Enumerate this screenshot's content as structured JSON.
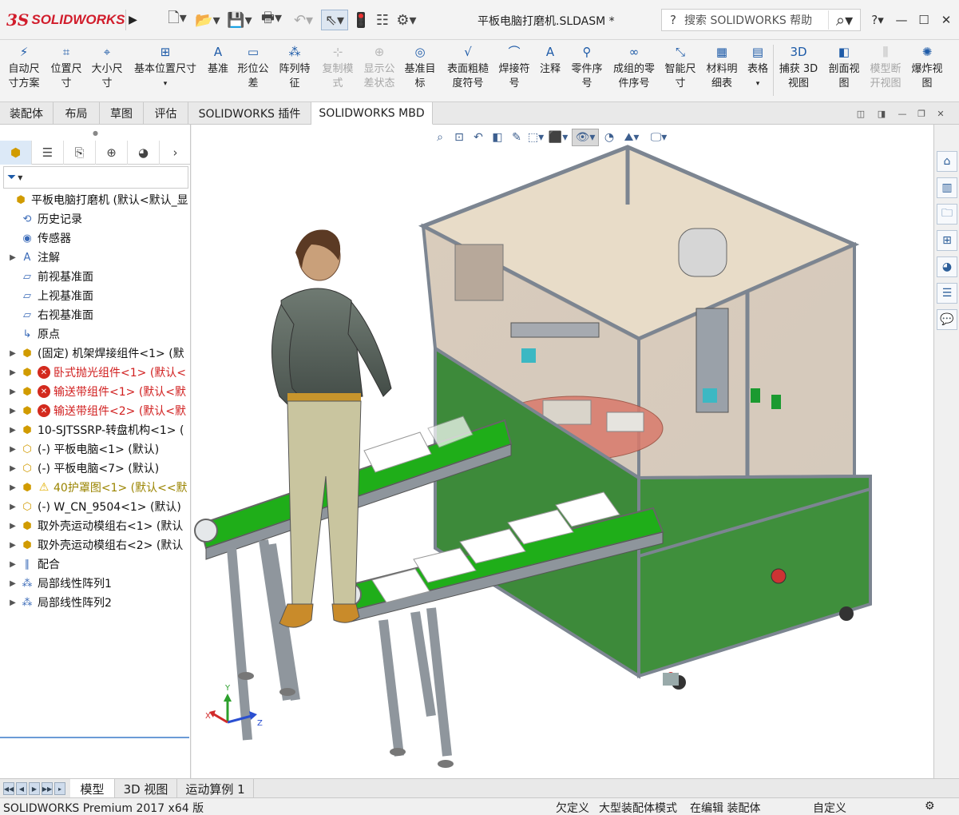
{
  "app": {
    "logo_ds": "3S",
    "logo_text": "SOLIDWORKS",
    "document_title": "平板电脑打磨机.SLDASM *",
    "search_placeholder": "搜索 SOLIDWORKS 帮助",
    "help_icon_label": "?"
  },
  "ribbon": {
    "buttons": [
      {
        "label1": "自动尺",
        "label2": "寸方案",
        "icon": "auto-dimension-icon",
        "enabled": true
      },
      {
        "label1": "位置尺",
        "label2": "寸",
        "icon": "location-dimension-icon",
        "enabled": true
      },
      {
        "label1": "大小尺",
        "label2": "寸",
        "icon": "size-dimension-icon",
        "enabled": true
      },
      {
        "label1": "基本位置尺寸",
        "label2": "",
        "icon": "basic-location-dimension-icon",
        "enabled": true
      },
      {
        "label1": "基准",
        "label2": "",
        "icon": "datum-icon",
        "enabled": true
      },
      {
        "label1": "形位公",
        "label2": "差",
        "icon": "geometric-tolerance-icon",
        "enabled": true
      },
      {
        "label1": "阵列特",
        "label2": "征",
        "icon": "pattern-feature-icon",
        "enabled": true
      },
      {
        "label1": "复制模",
        "label2": "式",
        "icon": "copy-scheme-icon",
        "enabled": false
      },
      {
        "label1": "显示公",
        "label2": "差状态",
        "icon": "show-tolerance-status-icon",
        "enabled": false
      },
      {
        "label1": "基准目",
        "label2": "标",
        "icon": "datum-target-icon",
        "enabled": true
      },
      {
        "label1": "表面粗糙",
        "label2": "度符号",
        "icon": "surface-finish-icon",
        "enabled": true
      },
      {
        "label1": "焊接符",
        "label2": "号",
        "icon": "weld-symbol-icon",
        "enabled": true
      },
      {
        "label1": "注释",
        "label2": "",
        "icon": "note-icon",
        "enabled": true
      },
      {
        "label1": "零件序",
        "label2": "号",
        "icon": "balloon-icon",
        "enabled": true
      },
      {
        "label1": "成组的零",
        "label2": "件序号",
        "icon": "stacked-balloon-icon",
        "enabled": true
      },
      {
        "label1": "智能尺",
        "label2": "寸",
        "icon": "smart-dimension-icon",
        "enabled": true
      },
      {
        "label1": "材料明",
        "label2": "细表",
        "icon": "bom-icon",
        "enabled": true
      },
      {
        "label1": "表格",
        "label2": "",
        "icon": "table-icon",
        "enabled": true
      },
      {
        "label1": "捕获 3D",
        "label2": "视图",
        "icon": "capture-3d-view-icon",
        "enabled": true
      },
      {
        "label1": "剖面视",
        "label2": "图",
        "icon": "section-view-icon",
        "enabled": true
      },
      {
        "label1": "模型断",
        "label2": "开视图",
        "icon": "model-break-view-icon",
        "enabled": false
      },
      {
        "label1": "爆炸视",
        "label2": "图",
        "icon": "exploded-view-icon",
        "enabled": true
      }
    ]
  },
  "tabs": [
    "装配体",
    "布局",
    "草图",
    "评估",
    "SOLIDWORKS 插件",
    "SOLIDWORKS MBD"
  ],
  "active_tab": "SOLIDWORKS MBD",
  "tree": {
    "filter_label": "▼",
    "items": [
      {
        "label": "平板电脑打磨机 (默认<默认_显",
        "icon": "assembly-icon",
        "expand": "",
        "status": "",
        "indent": 0
      },
      {
        "label": "历史记录",
        "icon": "history-icon",
        "expand": "",
        "status": "",
        "indent": 1
      },
      {
        "label": "传感器",
        "icon": "sensor-icon",
        "expand": "",
        "status": "",
        "indent": 1
      },
      {
        "label": "注解",
        "icon": "annotation-icon",
        "expand": "▶",
        "status": "",
        "indent": 1
      },
      {
        "label": "前视基准面",
        "icon": "plane-icon",
        "expand": "",
        "status": "",
        "indent": 1
      },
      {
        "label": "上视基准面",
        "icon": "plane-icon",
        "expand": "",
        "status": "",
        "indent": 1
      },
      {
        "label": "右视基准面",
        "icon": "plane-icon",
        "expand": "",
        "status": "",
        "indent": 1
      },
      {
        "label": "原点",
        "icon": "origin-icon",
        "expand": "",
        "status": "",
        "indent": 1
      },
      {
        "label": "(固定) 机架焊接组件<1> (默",
        "icon": "assembly-icon",
        "expand": "▶",
        "status": "",
        "indent": 1
      },
      {
        "label": "卧式抛光组件<1> (默认<",
        "icon": "assembly-icon",
        "expand": "▶",
        "status": "error",
        "indent": 1
      },
      {
        "label": "输送带组件<1> (默认<默",
        "icon": "assembly-icon",
        "expand": "▶",
        "status": "error",
        "indent": 1
      },
      {
        "label": "输送带组件<2> (默认<默",
        "icon": "assembly-icon",
        "expand": "▶",
        "status": "error",
        "indent": 1
      },
      {
        "label": "10-SJTSSRP-转盘机构<1> (",
        "icon": "assembly-icon",
        "expand": "▶",
        "status": "",
        "indent": 1
      },
      {
        "label": "(-) 平板电脑<1> (默认)",
        "icon": "part-icon",
        "expand": "▶",
        "status": "",
        "indent": 1
      },
      {
        "label": "(-) 平板电脑<7> (默认)",
        "icon": "part-icon",
        "expand": "▶",
        "status": "",
        "indent": 1
      },
      {
        "label": "40护罩图<1> (默认<<默",
        "icon": "assembly-icon",
        "expand": "▶",
        "status": "warning",
        "indent": 1
      },
      {
        "label": "(-) W_CN_9504<1> (默认)",
        "icon": "part-icon",
        "expand": "▶",
        "status": "",
        "indent": 1
      },
      {
        "label": "取外壳运动模组右<1> (默认",
        "icon": "assembly-icon",
        "expand": "▶",
        "status": "",
        "indent": 1
      },
      {
        "label": "取外壳运动模组右<2> (默认",
        "icon": "assembly-icon",
        "expand": "▶",
        "status": "",
        "indent": 1
      },
      {
        "label": "配合",
        "icon": "mates-icon",
        "expand": "▶",
        "status": "",
        "indent": 1
      },
      {
        "label": "局部线性阵列1",
        "icon": "linear-pattern-icon",
        "expand": "▶",
        "status": "",
        "indent": 1
      },
      {
        "label": "局部线性阵列2",
        "icon": "linear-pattern-icon",
        "expand": "▶",
        "status": "",
        "indent": 1
      }
    ]
  },
  "bottom_tabs": [
    "模型",
    "3D 视图",
    "运动算例 1"
  ],
  "active_bottom_tab": "模型",
  "status": {
    "product": "SOLIDWORKS Premium 2017 x64 版",
    "underdefined": "欠定义",
    "large_assembly": "大型装配体模式",
    "editing": "在编辑 装配体",
    "custom": "自定义"
  },
  "axis_triad": {
    "x": "X",
    "y": "Y",
    "z": "Z"
  },
  "colors": {
    "accent": "#1e5ba8",
    "brand_red": "#d11c2b",
    "error": "#d32a1e",
    "warning": "#e3b000",
    "conveyor_green": "#1fae19",
    "base_green": "#3d8a3a"
  }
}
